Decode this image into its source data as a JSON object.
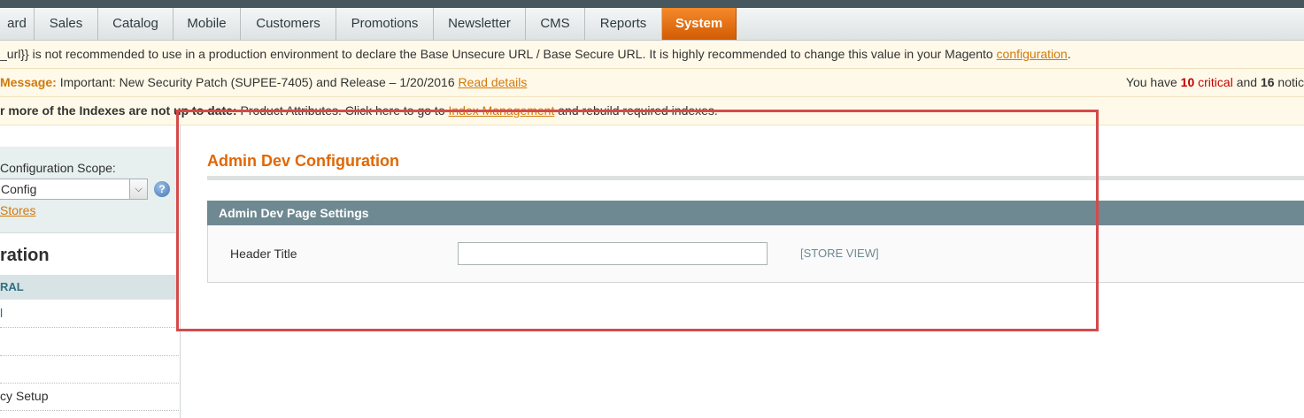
{
  "nav": {
    "items": [
      "ard",
      "Sales",
      "Catalog",
      "Mobile",
      "Customers",
      "Promotions",
      "Newsletter",
      "CMS",
      "Reports",
      "System"
    ],
    "active": "System"
  },
  "notices": {
    "base_url": {
      "text": "_url}} is not recommended to use in a production environment to declare the Base Unsecure URL / Base Secure URL. It is highly recommended to change this value in your Magento ",
      "link": "configuration",
      "suffix": "."
    },
    "message": {
      "label": "Message:",
      "text": " Important: New Security Patch (SUPEE-7405) and Release – 1/20/2016 ",
      "link": "Read details",
      "right_prefix": "You have ",
      "critical_count": "10",
      "critical_word": " critical",
      "right_mid": " and ",
      "notice_count": "16",
      "right_suffix": " notic"
    },
    "index": {
      "bold": "r more of the Indexes are not up to date:",
      "text": " Product Attributes. Click here to go to ",
      "link": "Index Management",
      "suffix": " and rebuild required indexes."
    }
  },
  "sidebar": {
    "scope_label": "Configuration Scope:",
    "scope_value": "Config",
    "stores_link": "Stores",
    "title": "ration",
    "section": "RAL",
    "items": [
      "l",
      "",
      "",
      "cy Setup"
    ]
  },
  "main": {
    "page_title": "Admin Dev Configuration",
    "fieldset_title": "Admin Dev Page Settings",
    "field_label": "Header Title",
    "field_value": "",
    "field_scope": "[STORE VIEW]"
  },
  "colors": {
    "accent": "#e26703",
    "active_tab": "#eb7214",
    "fieldset_header": "#6f8992",
    "highlight": "#d44a4a",
    "notice_bg": "#fff9e9"
  }
}
